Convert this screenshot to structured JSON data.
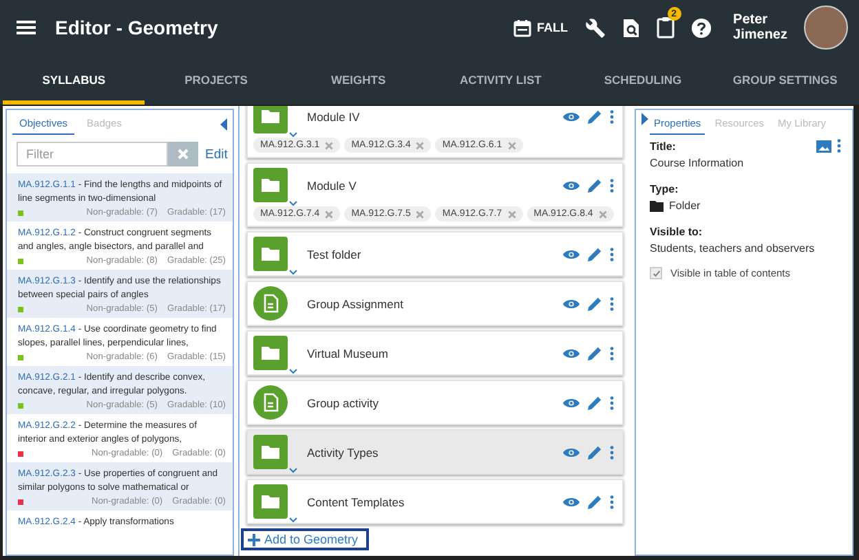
{
  "header": {
    "title": "Editor - Geometry",
    "term": "FALL",
    "notification_count": "2",
    "user_name": "Peter Jimenez"
  },
  "tabs": [
    {
      "label": "SYLLABUS",
      "selected": true
    },
    {
      "label": "PROJECTS",
      "selected": false
    },
    {
      "label": "WEIGHTS",
      "selected": false
    },
    {
      "label": "ACTIVITY LIST",
      "selected": false
    },
    {
      "label": "SCHEDULING",
      "selected": false
    },
    {
      "label": "GROUP SETTINGS",
      "selected": false
    }
  ],
  "left_panel": {
    "tabs": [
      {
        "label": "Objectives",
        "selected": true
      },
      {
        "label": "Badges",
        "selected": false
      }
    ],
    "filter": {
      "placeholder": "Filter"
    },
    "edit_link": "Edit",
    "objectives": [
      {
        "code": "MA.912.G.1.1",
        "description": "- Find the lengths and midpoints of line segments in two-dimensional",
        "color": "#7cc21f",
        "non_gradable": "Non-gradable: (7)",
        "gradable": "Gradable: (17)"
      },
      {
        "code": "MA.912.G.1.2",
        "description": "- Construct congruent segments and angles, angle bisectors, and parallel and",
        "color": "#7cc21f",
        "non_gradable": "Non-gradable: (8)",
        "gradable": "Gradable: (25)"
      },
      {
        "code": "MA.912.G.1.3",
        "description": "- Identify and use the relationships between special pairs of angles",
        "color": "#7cc21f",
        "non_gradable": "Non-gradable: (5)",
        "gradable": "Gradable: (17)"
      },
      {
        "code": "MA.912.G.1.4",
        "description": "- Use coordinate geometry to find slopes, parallel lines, perpendicular lines,",
        "color": "#7cc21f",
        "non_gradable": "Non-gradable: (6)",
        "gradable": "Gradable: (15)"
      },
      {
        "code": "MA.912.G.2.1",
        "description": "- Identify and describe convex, concave, regular, and irregular polygons.",
        "color": "#7cc21f",
        "non_gradable": "Non-gradable: (5)",
        "gradable": "Gradable: (10)"
      },
      {
        "code": "MA.912.G.2.2",
        "description": "- Determine the measures of interior and exterior angles of polygons,",
        "color": "#e8334a",
        "non_gradable": "Non-gradable: (0)",
        "gradable": "Gradable: (0)"
      },
      {
        "code": "MA.912.G.2.3",
        "description": "- Use properties of congruent and similar polygons to solve mathematical or",
        "color": "#e8334a",
        "non_gradable": "Non-gradable: (0)",
        "gradable": "Gradable: (0)"
      },
      {
        "code": "MA.912.G.2.4",
        "description": "- Apply transformations"
      }
    ]
  },
  "syllabus": {
    "items": [
      {
        "kind": "folder",
        "title": "Module IV",
        "selected": false,
        "tags": [
          "MA.912.G.3.1",
          "MA.912.G.3.4",
          "MA.912.G.6.1"
        ]
      },
      {
        "kind": "folder",
        "title": "Module V",
        "selected": false,
        "tags": [
          "MA.912.G.7.4",
          "MA.912.G.7.5",
          "MA.912.G.7.7",
          "MA.912.G.8.4"
        ]
      },
      {
        "kind": "folder",
        "title": "Test folder",
        "selected": false
      },
      {
        "kind": "assignment",
        "title": "Group Assignment",
        "selected": false
      },
      {
        "kind": "folder",
        "title": "Virtual Museum",
        "selected": false
      },
      {
        "kind": "assignment",
        "title": "Group activity",
        "selected": false
      },
      {
        "kind": "folder",
        "title": "Activity Types",
        "selected": true
      },
      {
        "kind": "folder",
        "title": "Content Templates",
        "selected": false
      }
    ],
    "add_button": "Add to Geometry"
  },
  "right_panel": {
    "tabs": [
      {
        "label": "Properties",
        "selected": true
      },
      {
        "label": "Resources",
        "selected": false
      },
      {
        "label": "My Library",
        "selected": false
      }
    ],
    "title_label": "Title:",
    "title_value": "Course Information",
    "type_label": "Type:",
    "type_value": "Folder",
    "visible_label": "Visible to:",
    "visible_value": "Students, teachers and observers",
    "toc_checkbox": {
      "label": "Visible in table of contents",
      "checked": true,
      "disabled": true
    }
  }
}
